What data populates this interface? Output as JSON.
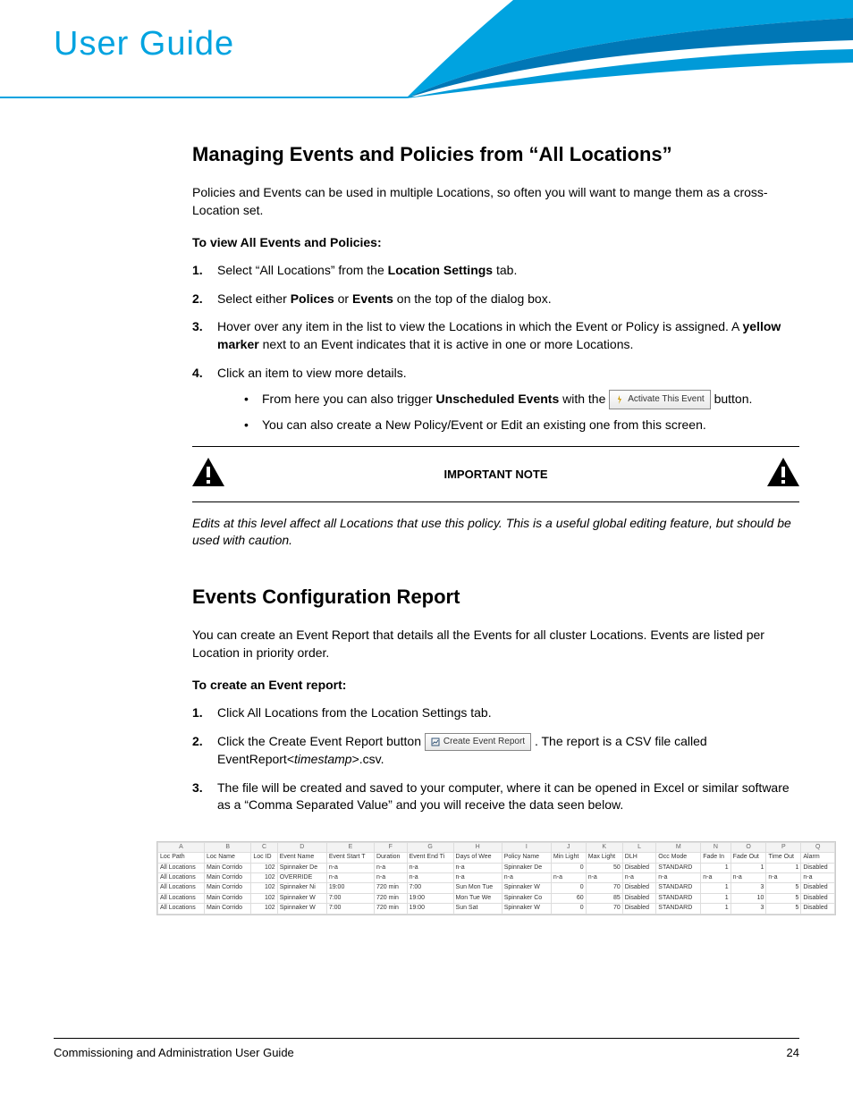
{
  "header": {
    "title": "User Guide"
  },
  "section1": {
    "heading": "Managing Events and Policies from “All Locations”",
    "intro": "Policies and Events can be used in multiple Locations, so often you will want to mange them as a cross-Location set.",
    "subhead": "To view All Events and Policies:",
    "steps": {
      "s1_a": "Select “All Locations” from the ",
      "s1_b": "Location Settings",
      "s1_c": " tab.",
      "s2_a": "Select either ",
      "s2_b": "Polices",
      "s2_c": " or ",
      "s2_d": "Events",
      "s2_e": " on the top of the dialog box.",
      "s3_a": "Hover over any item in the list to view the Locations in which the Event or Policy is assigned. A ",
      "s3_b": "yellow marker",
      "s3_c": " next to an Event indicates that it is active in one or more Locations.",
      "s4": "Click an item to view more details."
    },
    "bullets": {
      "b1_a": "From here you can also trigger ",
      "b1_b": "Unscheduled Events",
      "b1_c": " with the ",
      "b1_btn": "Activate This Event",
      "b1_d": " button.",
      "b2": "You can also create a New Policy/Event or Edit an existing one from this screen."
    },
    "important_label": "IMPORTANT NOTE",
    "important_text": "Edits at this level affect all Locations that use this policy. This is a useful global editing feature, but should be used with caution."
  },
  "section2": {
    "heading": "Events Configuration Report",
    "intro": "You can create an Event Report that details all the Events for all cluster Locations. Events are listed per Location in priority order.",
    "subhead": "To create an Event report:",
    "steps": {
      "s1": "Click All Locations from the Location Settings tab.",
      "s2_a": "Click the Create Event Report button ",
      "s2_btn": "Create Event Report",
      "s2_b": ". The report is a CSV file called EventReport<",
      "s2_c": "timestamp",
      "s2_d": ">.csv.",
      "s3": "The file will be created and saved to your computer, where it can be opened in Excel or similar software as a “Comma Separated Value” and you will receive the data seen below."
    }
  },
  "spreadsheet": {
    "cols": [
      "A",
      "B",
      "C",
      "D",
      "E",
      "F",
      "G",
      "H",
      "I",
      "J",
      "K",
      "L",
      "M",
      "N",
      "O",
      "P",
      "Q"
    ],
    "headers": [
      "Loc Path",
      "Loc Name",
      "Loc ID",
      "Event Name",
      "Event Start T",
      "Duration",
      "Event End Ti",
      "Days of Wee",
      "Policy Name",
      "Min Light",
      "Max Light",
      "DLH",
      "Occ Mode",
      "Fade In",
      "Fade Out",
      "Time Out",
      "Alarm"
    ],
    "rows": [
      [
        "All Locations",
        "Main Corrido",
        "102",
        "Spinnaker De",
        "n-a",
        "n-a",
        "n-a",
        "n-a",
        "Spinnaker De",
        "0",
        "50",
        "Disabled",
        "STANDARD",
        "1",
        "1",
        "1",
        "Disabled"
      ],
      [
        "All Locations",
        "Main Corrido",
        "102",
        "OVERRIDE",
        "n-a",
        "n-a",
        "n-a",
        "n-a",
        "n-a",
        "n-a",
        "n-a",
        "n-a",
        "n-a",
        "n-a",
        "n-a",
        "n-a",
        "n-a"
      ],
      [
        "All Locations",
        "Main Corrido",
        "102",
        "Spinnaker Ni",
        "19:00",
        "720 min",
        "7:00",
        "Sun Mon Tue",
        "Spinnaker W",
        "0",
        "70",
        "Disabled",
        "STANDARD",
        "1",
        "3",
        "5",
        "Disabled"
      ],
      [
        "All Locations",
        "Main Corrido",
        "102",
        "Spinnaker W",
        "7:00",
        "720 min",
        "19:00",
        "Mon Tue We",
        "Spinnaker Co",
        "60",
        "85",
        "Disabled",
        "STANDARD",
        "1",
        "10",
        "5",
        "Disabled"
      ],
      [
        "All Locations",
        "Main Corrido",
        "102",
        "Spinnaker W",
        "7:00",
        "720 min",
        "19:00",
        "Sun Sat",
        "Spinnaker W",
        "0",
        "70",
        "Disabled",
        "STANDARD",
        "1",
        "3",
        "5",
        "Disabled"
      ]
    ]
  },
  "footer": {
    "left": "Commissioning and Administration User Guide",
    "right": "24"
  }
}
